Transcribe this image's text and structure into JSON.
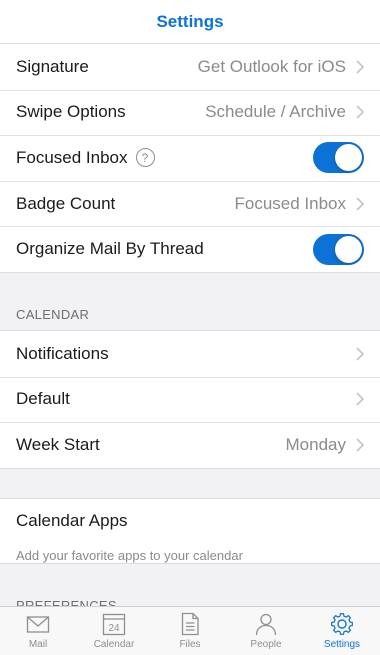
{
  "navbar": {
    "title": "Settings"
  },
  "mail_group": {
    "signature": {
      "label": "Signature",
      "value": "Get Outlook for iOS"
    },
    "swipe_options": {
      "label": "Swipe Options",
      "value": "Schedule / Archive"
    },
    "focused_inbox": {
      "label": "Focused Inbox",
      "help": "?",
      "enabled": true
    },
    "badge_count": {
      "label": "Badge Count",
      "value": "Focused Inbox"
    },
    "organize_by_thread": {
      "label": "Organize Mail By Thread",
      "enabled": true
    }
  },
  "calendar_section": {
    "header": "CALENDAR",
    "notifications": {
      "label": "Notifications"
    },
    "default": {
      "label": "Default"
    },
    "week_start": {
      "label": "Week Start",
      "value": "Monday"
    }
  },
  "calendar_apps": {
    "label": "Calendar Apps",
    "subtitle": "Add your favorite apps to your calendar"
  },
  "preferences_section": {
    "header": "PREFERENCES"
  },
  "tabbar": {
    "tabs": [
      {
        "label": "Mail",
        "icon": "mail-icon"
      },
      {
        "label": "Calendar",
        "icon": "calendar-icon",
        "day": "24"
      },
      {
        "label": "Files",
        "icon": "files-icon"
      },
      {
        "label": "People",
        "icon": "people-icon"
      },
      {
        "label": "Settings",
        "icon": "gear-icon",
        "active": true
      }
    ]
  },
  "colors": {
    "accent": "#0d72d6",
    "secondary_text": "#8a8a8f",
    "background": "#f2f2f4"
  }
}
